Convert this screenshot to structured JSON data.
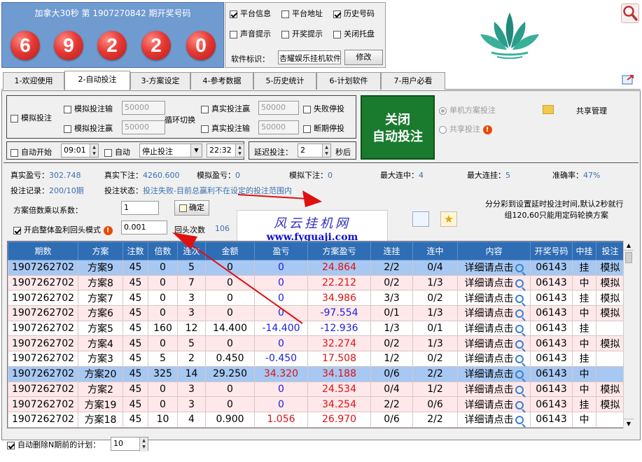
{
  "header": {
    "draw_title": "加拿大30秒 第 1907270842 期开奖号码",
    "balls": [
      "6",
      "9",
      "2",
      "2",
      "0"
    ]
  },
  "options": {
    "platform_info": {
      "label": "平台信息",
      "checked": true
    },
    "platform_addr": {
      "label": "平台地址",
      "checked": false
    },
    "history_num": {
      "label": "历史号码",
      "checked": true
    },
    "sound_tip": {
      "label": "声音提示",
      "checked": false
    },
    "draw_tip": {
      "label": "开奖提示",
      "checked": false
    },
    "close_tray": {
      "label": "关闭托盘",
      "checked": false
    },
    "software_label": "软件标识：",
    "software_value": "杏耀娱乐挂机软件",
    "modify_btn": "修改"
  },
  "tabs": [
    "1-欢迎使用",
    "2-自动投注",
    "3-方案设定",
    "4-参考数据",
    "5-历史统计",
    "6-计划软件",
    "7-用户必看"
  ],
  "active_tab": 1,
  "bet_panel": {
    "sim_bet": "模拟投注",
    "sim_bet_lose": "模拟投注输",
    "sim_bet_win": "模拟投注赢",
    "sim_lose_value": "50000",
    "sim_win_value": "50000",
    "loop_switch": "循环切换",
    "real_bet_win": "真实投注赢",
    "real_bet_lose": "真实投注输",
    "real_win_value": "50000",
    "real_lose_value": "50000",
    "fail_stop": "失败停投",
    "break_stop": "断期停投",
    "big_btn_line1": "关闭",
    "big_btn_line2": "自动投注",
    "single_plan": "单机方案投注",
    "share_bet": "共享投注",
    "share_manage": "共享管理",
    "auto_start": "自动开始",
    "auto_start_time": "09:01",
    "auto": "自动",
    "auto_action": "停止投注",
    "auto_time": "22:32",
    "delay_label": "延迟投注：",
    "delay_value": "2",
    "delay_unit": "秒后"
  },
  "stats": {
    "real_profit_label": "真实盈亏：",
    "real_profit": "302.748",
    "real_bet_label": "真实下注：",
    "real_bet": "4260.600",
    "sim_profit_label": "模拟盈亏：",
    "sim_profit": "0",
    "sim_bet_label": "模拟下注：",
    "sim_bet": "0",
    "max_win_label": "最大连中：",
    "max_win": "4",
    "max_lose_label": "最大连挂：",
    "max_lose": "5",
    "accuracy_label": "准确率：",
    "accuracy": "47%",
    "record_label": "投注记录：",
    "record": "200/10期",
    "status_label": "投注状态：",
    "status": "投注失败-目前总赢利不在设定的投注范围内",
    "multiplier_label": "方案倍数乘以系数：",
    "multiplier": "1",
    "confirm_btn": "确定",
    "rollback_label": "开启整体盈利回头模式",
    "rollback_value": "0.001",
    "rollback_count_label": "回头次数",
    "rollback_count": "106",
    "next_label": "下次",
    "note_line1": "分分彩到设置延时投注时间,默认2秒就行",
    "note_line2": "组120,60只能用定码轮换方案"
  },
  "table": {
    "headers": [
      "期数",
      "方案",
      "注数",
      "倍数",
      "连次",
      "金额",
      "盈亏",
      "方案盈亏",
      "连挂",
      "连中",
      "内容",
      "开奖号码",
      "中挂",
      "投注"
    ],
    "rows": [
      [
        "1907262702",
        "方案9",
        "45",
        "0",
        "5",
        "0",
        "0",
        "24.864",
        "2/2",
        "0/4",
        "详细请点击",
        "06143",
        "挂",
        "模拟"
      ],
      [
        "1907262702",
        "方案8",
        "45",
        "0",
        "7",
        "0",
        "0",
        "22.212",
        "0/2",
        "1/3",
        "详细请点击",
        "06143",
        "中",
        "模拟"
      ],
      [
        "1907262702",
        "方案7",
        "45",
        "0",
        "3",
        "0",
        "0",
        "34.986",
        "3/3",
        "0/2",
        "详细请点击",
        "06143",
        "挂",
        "模拟"
      ],
      [
        "1907262702",
        "方案6",
        "45",
        "0",
        "3",
        "0",
        "0",
        "-97.554",
        "0/1",
        "1/3",
        "详细请点击",
        "06143",
        "中",
        "模拟"
      ],
      [
        "1907262702",
        "方案5",
        "45",
        "160",
        "12",
        "14.400",
        "-14.400",
        "-12.936",
        "1/3",
        "0/1",
        "详细请点击",
        "06143",
        "挂",
        ""
      ],
      [
        "1907262702",
        "方案4",
        "45",
        "0",
        "5",
        "0",
        "0",
        "32.274",
        "0/2",
        "1/3",
        "详细请点击",
        "06143",
        "中",
        "模拟"
      ],
      [
        "1907262702",
        "方案3",
        "45",
        "5",
        "2",
        "0.450",
        "-0.450",
        "17.508",
        "1/2",
        "0/2",
        "详细请点击",
        "06143",
        "挂",
        ""
      ],
      [
        "1907262702",
        "方案20",
        "45",
        "325",
        "14",
        "29.250",
        "34.320",
        "34.188",
        "0/6",
        "2/2",
        "详细请点击",
        "06143",
        "中",
        ""
      ],
      [
        "1907262702",
        "方案2",
        "45",
        "0",
        "3",
        "0",
        "0",
        "24.534",
        "0/4",
        "1/2",
        "详细请点击",
        "06143",
        "中",
        "模拟"
      ],
      [
        "1907262702",
        "方案19",
        "45",
        "0",
        "3",
        "0",
        "0",
        "34.254",
        "2/2",
        "0/6",
        "详细请点击",
        "06143",
        "挂",
        "模拟"
      ],
      [
        "1907262702",
        "方案18",
        "45",
        "10",
        "4",
        "0.900",
        "1.056",
        "26.970",
        "0/6",
        "2/2",
        "详细请点击",
        "06143",
        "中",
        ""
      ]
    ],
    "selected_rows": [
      0,
      7
    ]
  },
  "bottom": {
    "auto_delete_label": "自动删除N期前的计划：",
    "auto_delete_value": "10"
  },
  "watermark": {
    "cn": "风云挂机网",
    "url": "www.fyguaji.com"
  },
  "colors": {
    "header_blue": "#6f9bd0",
    "ball_red": "#e53935",
    "table_header": "#2f6db5",
    "big_button": "#1a7a2e",
    "row_pink": "#ffe8ea",
    "row_selected": "#a7c8f2",
    "arrow_red": "#e01010"
  }
}
